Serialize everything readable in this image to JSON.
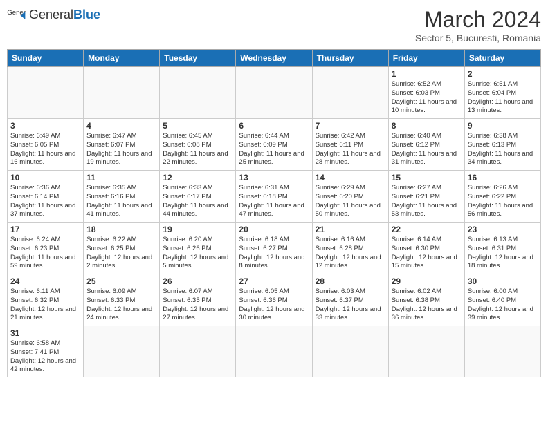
{
  "header": {
    "logo_text_normal": "General",
    "logo_text_blue": "Blue",
    "month": "March 2024",
    "location": "Sector 5, Bucuresti, Romania"
  },
  "days_of_week": [
    "Sunday",
    "Monday",
    "Tuesday",
    "Wednesday",
    "Thursday",
    "Friday",
    "Saturday"
  ],
  "weeks": [
    [
      {
        "day": "",
        "info": ""
      },
      {
        "day": "",
        "info": ""
      },
      {
        "day": "",
        "info": ""
      },
      {
        "day": "",
        "info": ""
      },
      {
        "day": "",
        "info": ""
      },
      {
        "day": "1",
        "info": "Sunrise: 6:52 AM\nSunset: 6:03 PM\nDaylight: 11 hours and 10 minutes."
      },
      {
        "day": "2",
        "info": "Sunrise: 6:51 AM\nSunset: 6:04 PM\nDaylight: 11 hours and 13 minutes."
      }
    ],
    [
      {
        "day": "3",
        "info": "Sunrise: 6:49 AM\nSunset: 6:05 PM\nDaylight: 11 hours and 16 minutes."
      },
      {
        "day": "4",
        "info": "Sunrise: 6:47 AM\nSunset: 6:07 PM\nDaylight: 11 hours and 19 minutes."
      },
      {
        "day": "5",
        "info": "Sunrise: 6:45 AM\nSunset: 6:08 PM\nDaylight: 11 hours and 22 minutes."
      },
      {
        "day": "6",
        "info": "Sunrise: 6:44 AM\nSunset: 6:09 PM\nDaylight: 11 hours and 25 minutes."
      },
      {
        "day": "7",
        "info": "Sunrise: 6:42 AM\nSunset: 6:11 PM\nDaylight: 11 hours and 28 minutes."
      },
      {
        "day": "8",
        "info": "Sunrise: 6:40 AM\nSunset: 6:12 PM\nDaylight: 11 hours and 31 minutes."
      },
      {
        "day": "9",
        "info": "Sunrise: 6:38 AM\nSunset: 6:13 PM\nDaylight: 11 hours and 34 minutes."
      }
    ],
    [
      {
        "day": "10",
        "info": "Sunrise: 6:36 AM\nSunset: 6:14 PM\nDaylight: 11 hours and 37 minutes."
      },
      {
        "day": "11",
        "info": "Sunrise: 6:35 AM\nSunset: 6:16 PM\nDaylight: 11 hours and 41 minutes."
      },
      {
        "day": "12",
        "info": "Sunrise: 6:33 AM\nSunset: 6:17 PM\nDaylight: 11 hours and 44 minutes."
      },
      {
        "day": "13",
        "info": "Sunrise: 6:31 AM\nSunset: 6:18 PM\nDaylight: 11 hours and 47 minutes."
      },
      {
        "day": "14",
        "info": "Sunrise: 6:29 AM\nSunset: 6:20 PM\nDaylight: 11 hours and 50 minutes."
      },
      {
        "day": "15",
        "info": "Sunrise: 6:27 AM\nSunset: 6:21 PM\nDaylight: 11 hours and 53 minutes."
      },
      {
        "day": "16",
        "info": "Sunrise: 6:26 AM\nSunset: 6:22 PM\nDaylight: 11 hours and 56 minutes."
      }
    ],
    [
      {
        "day": "17",
        "info": "Sunrise: 6:24 AM\nSunset: 6:23 PM\nDaylight: 11 hours and 59 minutes."
      },
      {
        "day": "18",
        "info": "Sunrise: 6:22 AM\nSunset: 6:25 PM\nDaylight: 12 hours and 2 minutes."
      },
      {
        "day": "19",
        "info": "Sunrise: 6:20 AM\nSunset: 6:26 PM\nDaylight: 12 hours and 5 minutes."
      },
      {
        "day": "20",
        "info": "Sunrise: 6:18 AM\nSunset: 6:27 PM\nDaylight: 12 hours and 8 minutes."
      },
      {
        "day": "21",
        "info": "Sunrise: 6:16 AM\nSunset: 6:28 PM\nDaylight: 12 hours and 12 minutes."
      },
      {
        "day": "22",
        "info": "Sunrise: 6:14 AM\nSunset: 6:30 PM\nDaylight: 12 hours and 15 minutes."
      },
      {
        "day": "23",
        "info": "Sunrise: 6:13 AM\nSunset: 6:31 PM\nDaylight: 12 hours and 18 minutes."
      }
    ],
    [
      {
        "day": "24",
        "info": "Sunrise: 6:11 AM\nSunset: 6:32 PM\nDaylight: 12 hours and 21 minutes."
      },
      {
        "day": "25",
        "info": "Sunrise: 6:09 AM\nSunset: 6:33 PM\nDaylight: 12 hours and 24 minutes."
      },
      {
        "day": "26",
        "info": "Sunrise: 6:07 AM\nSunset: 6:35 PM\nDaylight: 12 hours and 27 minutes."
      },
      {
        "day": "27",
        "info": "Sunrise: 6:05 AM\nSunset: 6:36 PM\nDaylight: 12 hours and 30 minutes."
      },
      {
        "day": "28",
        "info": "Sunrise: 6:03 AM\nSunset: 6:37 PM\nDaylight: 12 hours and 33 minutes."
      },
      {
        "day": "29",
        "info": "Sunrise: 6:02 AM\nSunset: 6:38 PM\nDaylight: 12 hours and 36 minutes."
      },
      {
        "day": "30",
        "info": "Sunrise: 6:00 AM\nSunset: 6:40 PM\nDaylight: 12 hours and 39 minutes."
      }
    ],
    [
      {
        "day": "31",
        "info": "Sunrise: 6:58 AM\nSunset: 7:41 PM\nDaylight: 12 hours and 42 minutes."
      },
      {
        "day": "",
        "info": ""
      },
      {
        "day": "",
        "info": ""
      },
      {
        "day": "",
        "info": ""
      },
      {
        "day": "",
        "info": ""
      },
      {
        "day": "",
        "info": ""
      },
      {
        "day": "",
        "info": ""
      }
    ]
  ]
}
